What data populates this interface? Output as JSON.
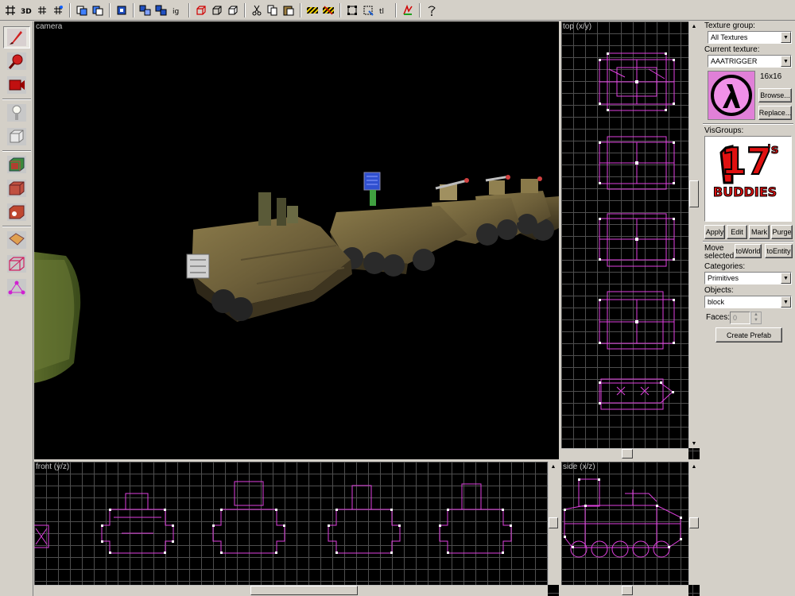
{
  "viewports": {
    "camera": "camera",
    "top": "top (x/y)",
    "front": "front (y/z)",
    "side": "side (x/z)"
  },
  "toolbar": {
    "icons": [
      "grid-icon",
      "3d-grid-icon",
      "smaller-grid-icon",
      "larger-grid-icon",
      "undo-icon",
      "redo-icon",
      "group-icon",
      "ungroup-icon",
      "ignore-group-icon",
      "carve-icon",
      "hollow-icon",
      "clip-icon",
      "cut-icon",
      "copy-icon",
      "paste-icon",
      "texture-lock-icon",
      "texture-scale-lock-icon",
      "select-box-icon",
      "select-all-icon",
      "toggle-icon",
      "compile-icon",
      "help-icon"
    ]
  },
  "tools": [
    "selection-tool",
    "magnify-tool",
    "camera-tool",
    "entity-tool",
    "block-tool",
    "texture-application-tool",
    "apply-current-texture-tool",
    "decal-tool",
    "overlay-tool",
    "clipping-tool",
    "vertex-tool",
    "path-tool"
  ],
  "panel": {
    "texture_group_label": "Texture group:",
    "texture_group_value": "All Textures",
    "current_texture_label": "Current texture:",
    "current_texture_value": "AAATRIGGER",
    "texture_size": "16x16",
    "browse": "Browse...",
    "replace": "Replace...",
    "visgroups_label": "VisGroups:",
    "visgroup_logo_main": "17",
    "visgroup_logo_sup": "'s",
    "visgroup_logo_sub": "BUDDIES",
    "apply": "Apply",
    "edit": "Edit",
    "mark": "Mark",
    "purge": "Purge",
    "move_selected_label_1": "Move",
    "move_selected_label_2": "selected:",
    "to_world": "toWorld",
    "to_entity": "toEntity",
    "categories_label": "Categories:",
    "categories_value": "Primitives",
    "objects_label": "Objects:",
    "objects_value": "block",
    "faces_label": "Faces:",
    "faces_value": "0",
    "create_prefab": "Create Prefab"
  },
  "colors": {
    "wireframe": "#e040e0",
    "vertex": "#ffffff",
    "grid": "#4e4e4e",
    "axis": "#1a8a8a"
  }
}
